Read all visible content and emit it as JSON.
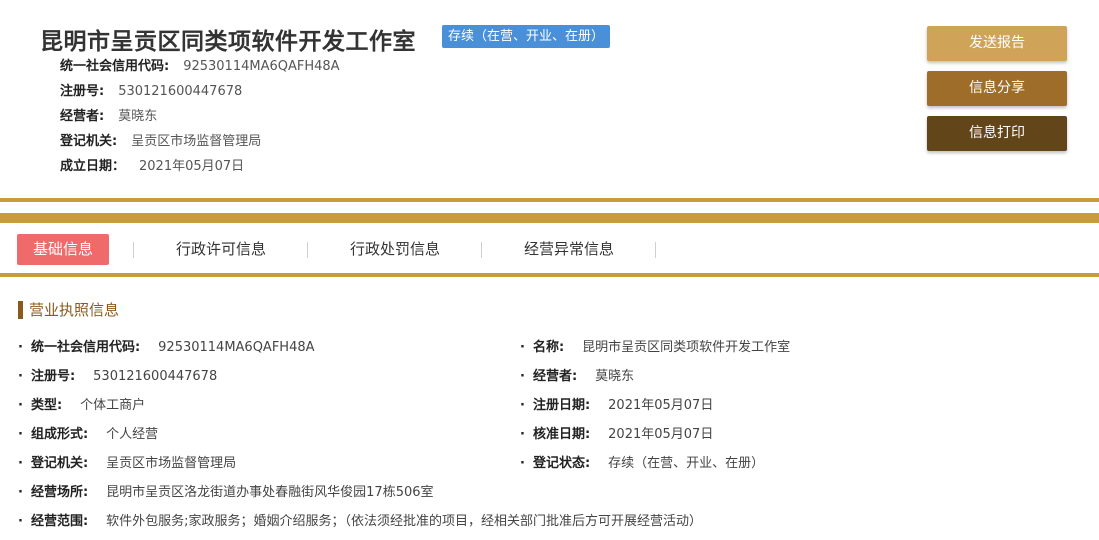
{
  "header": {
    "company_name": "昆明市呈贡区同类项软件开发工作室",
    "status": "存续（在营、开业、在册）",
    "rows": [
      {
        "label": "统一社会信用代码:",
        "value": "92530114MA6QAFH48A"
      },
      {
        "label": "注册号:",
        "value": "530121600447678"
      },
      {
        "label": "经营者:",
        "value": "莫晓东"
      },
      {
        "label": "登记机关:",
        "value": "呈贡区市场监督管理局"
      },
      {
        "label": "成立日期：",
        "value": "2021年05月07日"
      }
    ]
  },
  "actions": {
    "send_report": "发送报告",
    "share": "信息分享",
    "print": "信息打印"
  },
  "tabs": [
    {
      "label": "基础信息",
      "active": true
    },
    {
      "label": "行政许可信息",
      "active": false
    },
    {
      "label": "行政处罚信息",
      "active": false
    },
    {
      "label": "经营异常信息",
      "active": false
    }
  ],
  "section": {
    "title": "营业执照信息",
    "bullet": "·",
    "left_fields": [
      {
        "label": "统一社会信用代码:",
        "value": "92530114MA6QAFH48A"
      },
      {
        "label": "注册号:",
        "value": "530121600447678"
      },
      {
        "label": "类型:",
        "value": "个体工商户"
      },
      {
        "label": "组成形式:",
        "value": "个人经营"
      },
      {
        "label": "登记机关:",
        "value": "呈贡区市场监督管理局"
      },
      {
        "label": "经营场所:",
        "value": "昆明市呈贡区洛龙街道办事处春融街风华俊园17栋506室"
      },
      {
        "label": "经营范围:",
        "value": "软件外包服务;家政服务；婚姻介绍服务；（依法须经批准的项目，经相关部门批准后方可开展经营活动）"
      }
    ],
    "right_fields": [
      {
        "label": "名称:",
        "value": "昆明市呈贡区同类项软件开发工作室"
      },
      {
        "label": "经营者:",
        "value": "莫晓东"
      },
      {
        "label": "注册日期:",
        "value": "2021年05月07日"
      },
      {
        "label": "核准日期:",
        "value": "2021年05月07日"
      },
      {
        "label": "登记状态:",
        "value": "存续（在营、开业、在册）"
      }
    ]
  },
  "colors": {
    "gold": "#c89b3b",
    "badge_blue": "#4a90d9",
    "tab_active": "#ef6a6a",
    "section_brown": "#8a5a1c"
  }
}
